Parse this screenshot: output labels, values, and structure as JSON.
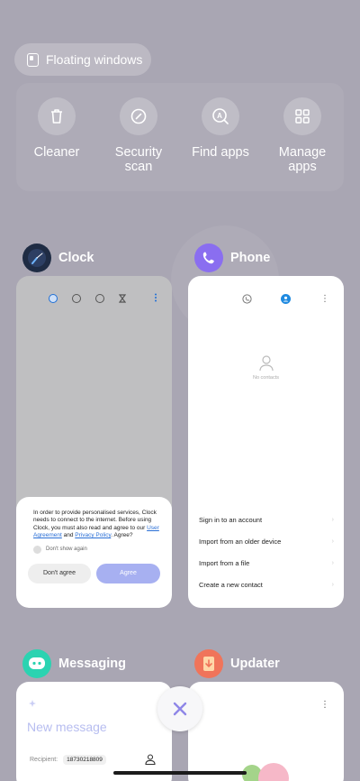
{
  "floating": {
    "label": "Floating windows"
  },
  "tools": [
    {
      "label": "Cleaner",
      "icon": "trash-icon"
    },
    {
      "label": "Security scan",
      "icon": "shield-check-icon"
    },
    {
      "label": "Find apps",
      "icon": "find-apps-icon"
    },
    {
      "label": "Manage apps",
      "icon": "grid-icon"
    }
  ],
  "apps": {
    "clock": {
      "name": "Clock",
      "icon_color": "#1f2c44",
      "dialog": {
        "text_before": "In order to provide personalised services, Clock needs to connect to the internet. Before using Clock, you must also read and agree to our ",
        "link_user_agreement": "User Agreement",
        "and": " and ",
        "link_privacy": "Privacy Policy",
        "text_after": ". Agree?",
        "dont_show": "Don't show again",
        "disagree": "Don't agree",
        "agree": "Agree"
      }
    },
    "phone": {
      "name": "Phone",
      "icon_color": "#8a6ef0",
      "empty": "No contacts",
      "menu": [
        "Sign in to an account",
        "Import from an older device",
        "Import from a file",
        "Create a new contact"
      ]
    },
    "messaging": {
      "name": "Messaging",
      "icon_color": "#2bd3b1",
      "new_message": "New message",
      "recipient_label": "Recipient:",
      "recipient_value": "18730218809"
    },
    "updater": {
      "name": "Updater",
      "icon_color": "#f0745a"
    }
  },
  "colors": {
    "accent": "#2a6fd6",
    "agree_button": "#a7b0f1",
    "background": "#a9a6b3"
  }
}
